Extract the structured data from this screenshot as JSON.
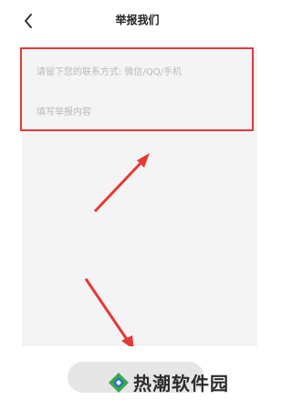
{
  "header": {
    "title": "举报我们"
  },
  "form": {
    "contact_placeholder": "请留下您的联系方式: 微信/QQ/手机",
    "content_placeholder": "填写举报内容"
  },
  "watermark": {
    "text": "热潮软件园"
  },
  "colors": {
    "highlight": "#e03a3a",
    "arrow": "#e53935",
    "logo_green": "#3aa84a",
    "logo_blue": "#2a6fc9"
  }
}
